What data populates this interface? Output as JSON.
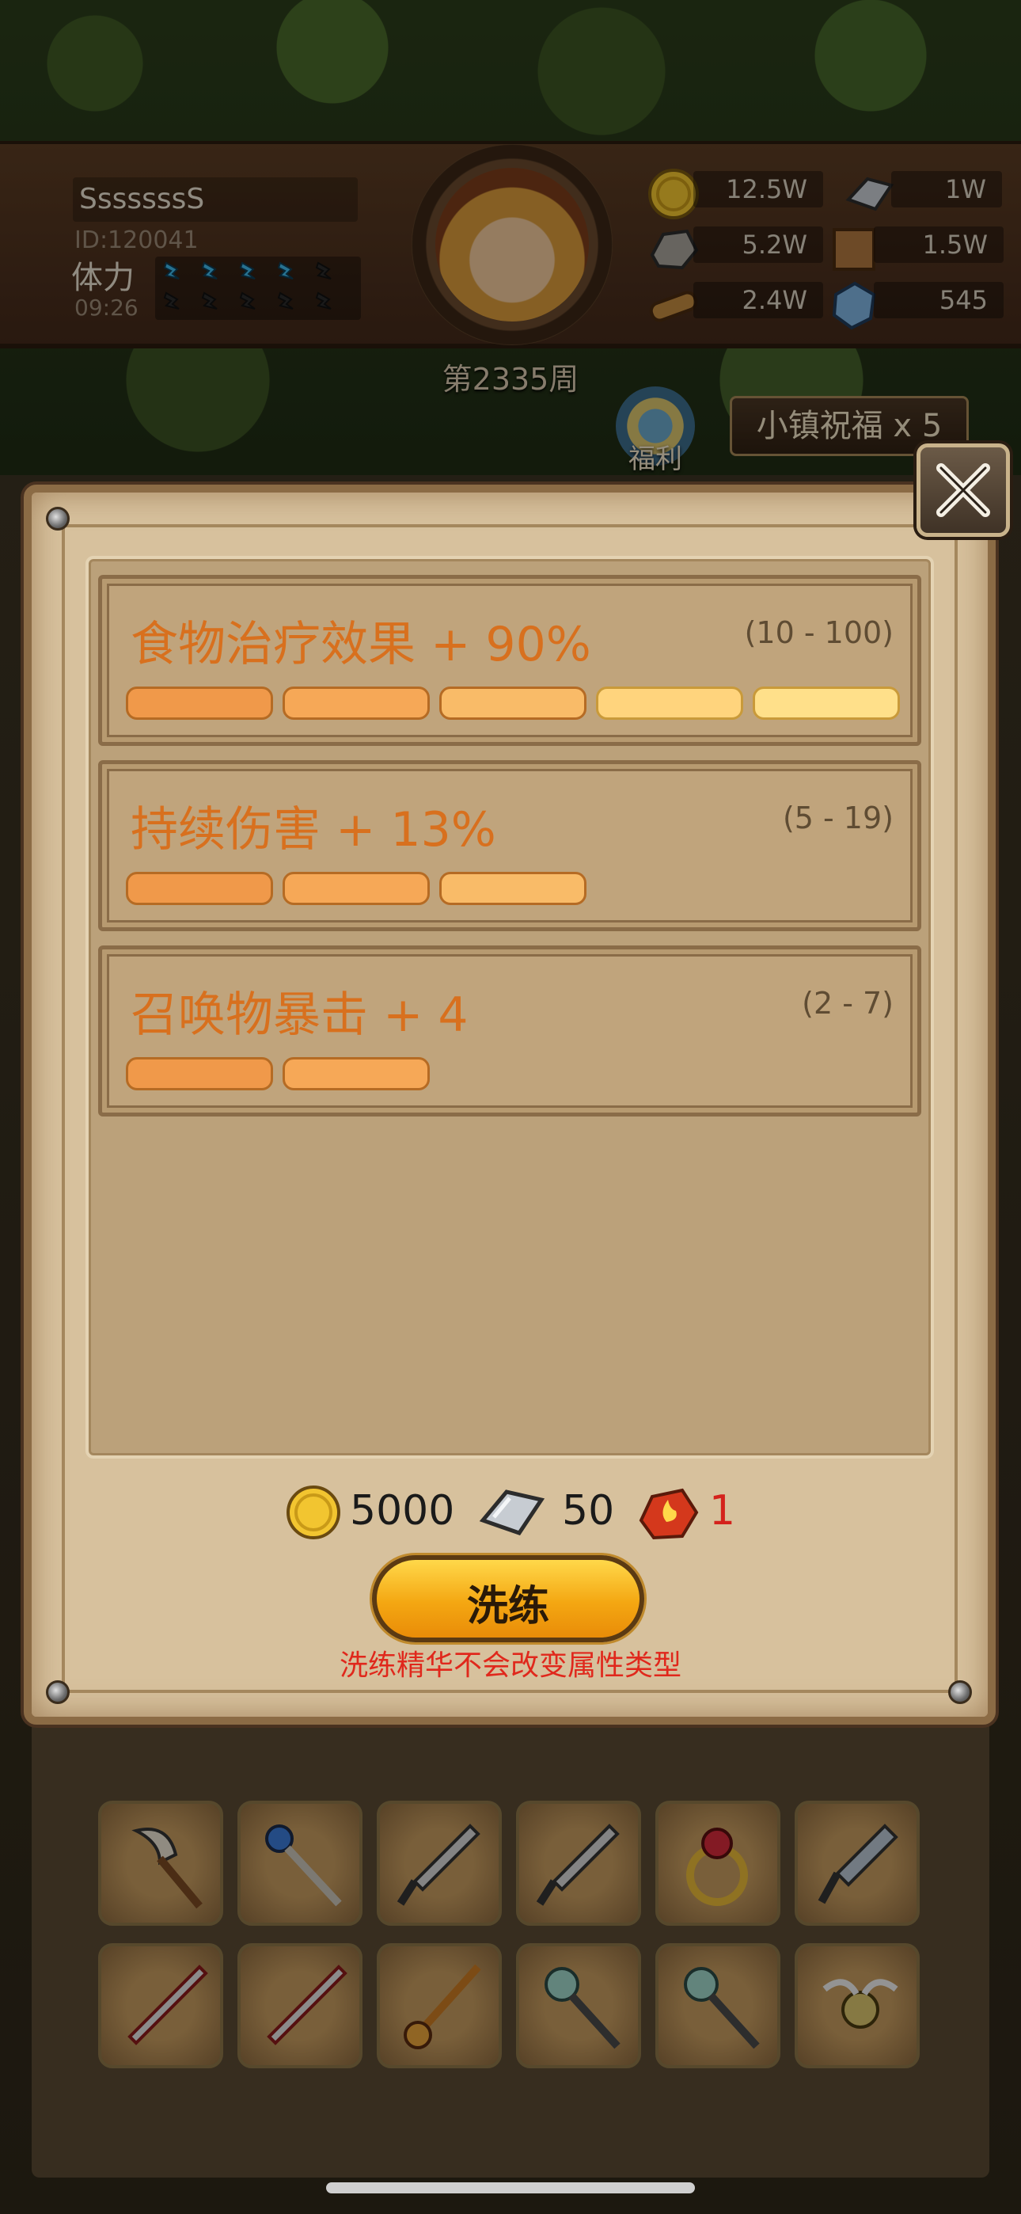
{
  "player": {
    "name": "SssssssS",
    "id": "ID:120041",
    "stamina_label": "体力",
    "stamina_timer": "09:26",
    "week": "第2335周"
  },
  "resources": [
    {
      "icon": "gold-coin-icon",
      "value": "12.5W"
    },
    {
      "icon": "iron-ingot-icon",
      "value": "1W"
    },
    {
      "icon": "stone-icon",
      "value": "5.2W"
    },
    {
      "icon": "leather-icon",
      "value": "1.5W"
    },
    {
      "icon": "wood-log-icon",
      "value": "2.4W"
    },
    {
      "icon": "crystal-icon",
      "value": "545"
    }
  ],
  "events": {
    "welfare_label": "福利",
    "blessing_label": "小镇祝福 x 5"
  },
  "attributes": [
    {
      "name": "食物治疗效果 + 90%",
      "range": "(10 - 100)",
      "filled_segments": 5
    },
    {
      "name": "持续伤害 + 13%",
      "range": "(5 - 19)",
      "filled_segments": 3
    },
    {
      "name": "召唤物暴击 + 4",
      "range": "(2 - 7)",
      "filled_segments": 2
    }
  ],
  "costs": [
    {
      "icon": "gold-coin-icon",
      "value": "5000",
      "color": "#1a1a1a"
    },
    {
      "icon": "iron-ingot-icon",
      "value": "50",
      "color": "#1a1a1a"
    },
    {
      "icon": "fire-essence-icon",
      "value": "1",
      "color": "#d4221c"
    }
  ],
  "refine_button_label": "洗练",
  "hint": "洗练精华不会改变属性类型",
  "colors": {
    "accent_orange": "#d8701e",
    "hint_red": "#e0281c",
    "segment_dark": "#f0994a",
    "segment_light": "#ffe08a"
  }
}
